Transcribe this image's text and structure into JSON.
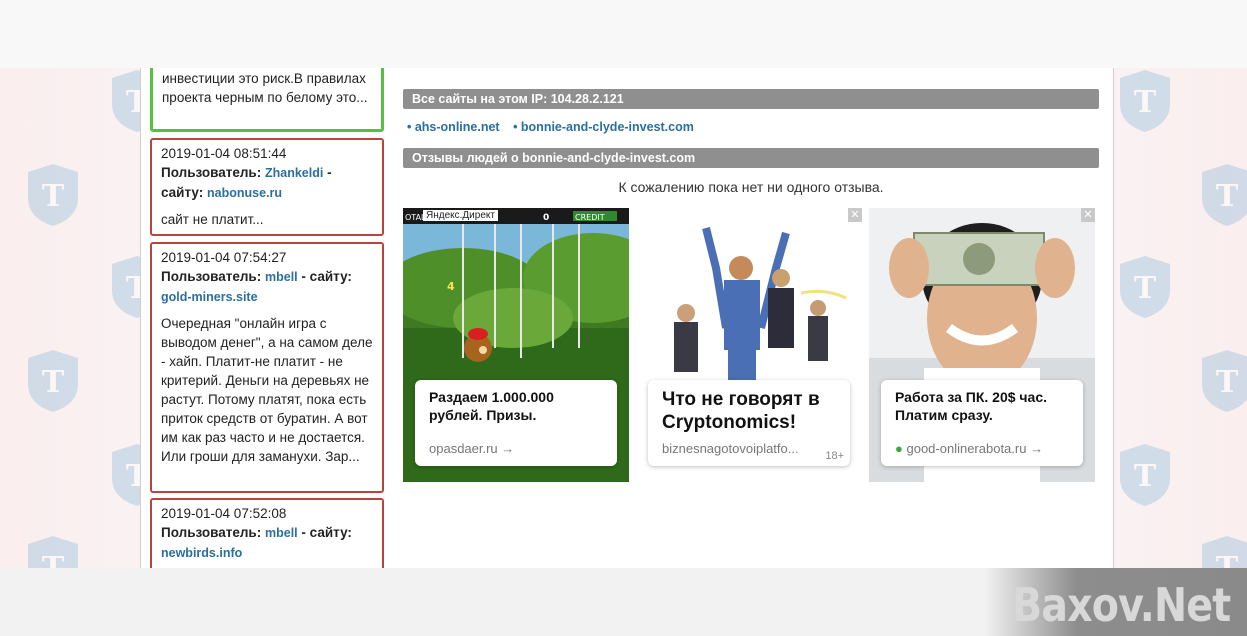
{
  "sidebar": {
    "reviews": [
      {
        "body": "инвестиции это риск.В правилах проекта черным по белому это..."
      },
      {
        "date": "2019-01-04 08:51:44",
        "user_label": "Пользователь:",
        "user": "Zhankeldi",
        "site_label": "- сайту:",
        "site": "nabonuse.ru",
        "body": "сайт не платит..."
      },
      {
        "date": "2019-01-04 07:54:27",
        "user_label": "Пользователь:",
        "user": "mbell",
        "site_label": "- сайту:",
        "site": "gold-miners.site",
        "body": "Очередная \"онлайн игра с выводом денег\", а на самом деле - хайп. Платит-не платит - не критерий. Деньги на деревьях не растут. Потому платят, пока есть приток средств от буратин. А вот им как раз часто и не достается. Или гроши для заманухи. Зар..."
      },
      {
        "date": "2019-01-04 07:52:08",
        "user_label": "Пользователь:",
        "user": "mbell",
        "site_label": "- сайту:",
        "site": "newbirds.info"
      }
    ]
  },
  "main": {
    "ip_header": "Все сайты на этом IP: 104.28.2.121",
    "sites": [
      "• ahs-online.net",
      "• bonnie-and-clyde-invest.com"
    ],
    "reviews_header": "Отзывы людей о bonnie-and-clyde-invest.com",
    "no_reviews": "К сожалению пока нет ни одного отзыва."
  },
  "ads": [
    {
      "label": "Яндекс.Директ",
      "title": "Раздаем 1.000.000 рублей. Призы.",
      "domain": "opasdaer.ru →",
      "game_text": {
        "left": "OTAL B",
        "credit": "CREDIT",
        "num": "4",
        "zero": "0"
      }
    },
    {
      "close": "✕",
      "title": "Что не говорят в Cryptonomics!",
      "domain": "biznesnagotovoiplatfo...",
      "age": "18+"
    },
    {
      "close": "✕",
      "title": "Работа за ПК. 20$ час. Платим сразу.",
      "domain": "good-onlinerabota.ru →"
    }
  ],
  "watermark": "Baxov.Net",
  "colors": {
    "accent_link": "#2a6fa0",
    "header_bar": "#8f8f8f",
    "card_border_red": "#b5453f",
    "card_border_green": "#54c240"
  }
}
